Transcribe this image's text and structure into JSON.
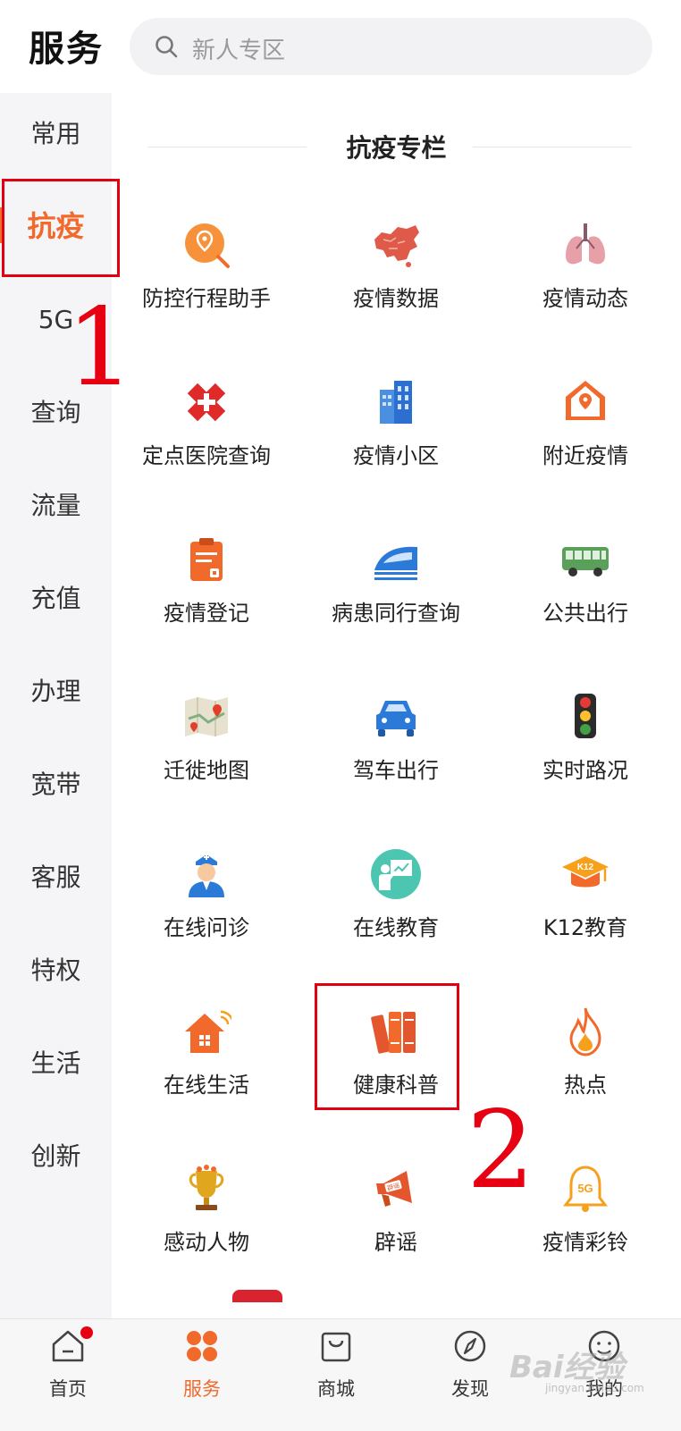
{
  "header": {
    "title": "服务",
    "search_placeholder": "新人专区"
  },
  "sidebar": {
    "items": [
      {
        "label": "常用"
      },
      {
        "label": "抗疫",
        "active": true
      },
      {
        "label": "5G"
      },
      {
        "label": "查询"
      },
      {
        "label": "流量"
      },
      {
        "label": "充值"
      },
      {
        "label": "办理"
      },
      {
        "label": "宽带"
      },
      {
        "label": "客服"
      },
      {
        "label": "特权"
      },
      {
        "label": "生活"
      },
      {
        "label": "创新"
      }
    ]
  },
  "section": {
    "title": "抗疫专栏",
    "items": [
      {
        "label": "防控行程助手",
        "icon": "location-pin-icon"
      },
      {
        "label": "疫情数据",
        "icon": "china-map-icon"
      },
      {
        "label": "疫情动态",
        "icon": "lungs-icon"
      },
      {
        "label": "定点医院查询",
        "icon": "medical-cross-icon"
      },
      {
        "label": "疫情小区",
        "icon": "building-icon"
      },
      {
        "label": "附近疫情",
        "icon": "house-location-icon"
      },
      {
        "label": "疫情登记",
        "icon": "clipboard-icon"
      },
      {
        "label": "病患同行查询",
        "icon": "train-icon"
      },
      {
        "label": "公共出行",
        "icon": "bus-icon"
      },
      {
        "label": "迁徙地图",
        "icon": "folded-map-icon"
      },
      {
        "label": "驾车出行",
        "icon": "car-icon"
      },
      {
        "label": "实时路况",
        "icon": "traffic-light-icon"
      },
      {
        "label": "在线问诊",
        "icon": "nurse-icon"
      },
      {
        "label": "在线教育",
        "icon": "teacher-icon"
      },
      {
        "label": "K12教育",
        "icon": "graduation-cap-icon"
      },
      {
        "label": "在线生活",
        "icon": "smart-home-icon"
      },
      {
        "label": "健康科普",
        "icon": "books-icon"
      },
      {
        "label": "热点",
        "icon": "flame-icon"
      },
      {
        "label": "感动人物",
        "icon": "trophy-icon"
      },
      {
        "label": "辟谣",
        "icon": "megaphone-icon",
        "badge": "辟谣"
      },
      {
        "label": "疫情彩铃",
        "icon": "bell-5g-icon",
        "badge": "5G"
      }
    ]
  },
  "annotations": {
    "mark1": "1",
    "mark2": "2"
  },
  "icon_texts": {
    "k12": "K12"
  },
  "bottom_nav": {
    "items": [
      {
        "label": "首页",
        "icon": "home-icon",
        "has_badge": true
      },
      {
        "label": "服务",
        "icon": "service-grid-icon",
        "active": true
      },
      {
        "label": "商城",
        "icon": "shopping-bag-icon"
      },
      {
        "label": "发现",
        "icon": "compass-icon"
      },
      {
        "label": "我的",
        "icon": "profile-icon"
      }
    ]
  },
  "watermark": {
    "text": "Bai经验",
    "sub": "jingyan.baidu.com"
  },
  "colors": {
    "accent": "#f26a2b",
    "annotation": "#e60012",
    "sidebar_bg": "#f5f5f7"
  }
}
